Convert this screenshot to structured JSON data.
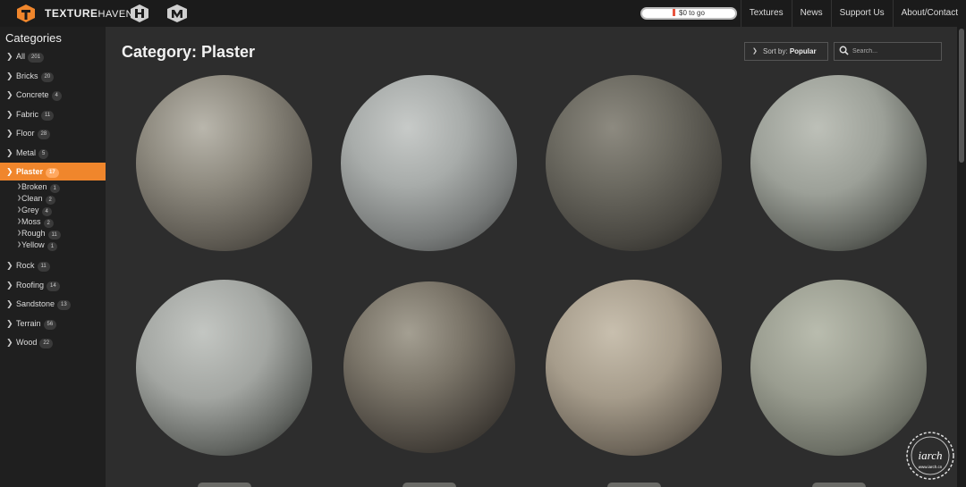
{
  "header": {
    "brand_strong": "TEXTURE",
    "brand_rest": "HAVEN",
    "patreon_label": "$0 to go",
    "nav": [
      "Textures",
      "News",
      "Support Us",
      "About/Contact"
    ]
  },
  "colors": {
    "accent": "#f0862c",
    "background": "#2d2d2d",
    "sidebar": "#1f1f1f",
    "topbar": "#1b1b1b"
  },
  "sidebar": {
    "title": "Categories",
    "categories": [
      {
        "label": "All",
        "count": "201"
      },
      {
        "label": "Bricks",
        "count": "20"
      },
      {
        "label": "Concrete",
        "count": "4"
      },
      {
        "label": "Fabric",
        "count": "11"
      },
      {
        "label": "Floor",
        "count": "28"
      },
      {
        "label": "Metal",
        "count": "5"
      },
      {
        "label": "Plaster",
        "count": "17",
        "active": true
      },
      {
        "label": "Rock",
        "count": "11"
      },
      {
        "label": "Roofing",
        "count": "14"
      },
      {
        "label": "Sandstone",
        "count": "13"
      },
      {
        "label": "Terrain",
        "count": "56"
      },
      {
        "label": "Wood",
        "count": "22"
      }
    ],
    "subcategories": [
      {
        "label": "Broken",
        "count": "1"
      },
      {
        "label": "Clean",
        "count": "2"
      },
      {
        "label": "Grey",
        "count": "4"
      },
      {
        "label": "Moss",
        "count": "2"
      },
      {
        "label": "Rough",
        "count": "11"
      },
      {
        "label": "Yellow",
        "count": "1"
      }
    ]
  },
  "main": {
    "title": "Category: Plaster",
    "sort_prefix": "Sort by:",
    "sort_value": "Popular",
    "search_placeholder": "Search...",
    "textures": [
      "plaster-texture",
      "plaster-texture",
      "plaster-texture",
      "plaster-texture",
      "plaster-texture",
      "plaster-texture",
      "plaster-texture",
      "plaster-texture"
    ]
  },
  "watermark": {
    "text": "iarch",
    "sub": "www.iarch.cn"
  }
}
